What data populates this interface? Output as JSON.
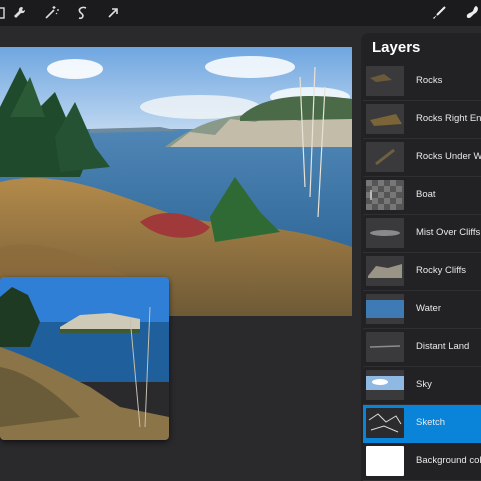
{
  "toolbar": {
    "left_icons": [
      "wrench-icon",
      "magic-wand-icon",
      "selection-icon",
      "transform-arrow-icon"
    ],
    "right_icons": [
      "brush-icon",
      "smudge-icon"
    ]
  },
  "layers_panel": {
    "title": "Layers",
    "selected_layer": "Sketch",
    "layers": [
      {
        "name": "Rocks"
      },
      {
        "name": "Rocks Right End"
      },
      {
        "name": "Rocks Under W"
      },
      {
        "name": "Boat"
      },
      {
        "name": "Mist Over Cliffs"
      },
      {
        "name": "Rocky Cliffs"
      },
      {
        "name": "Water"
      },
      {
        "name": "Distant Land"
      },
      {
        "name": "Sky"
      },
      {
        "name": "Sketch"
      },
      {
        "name": "Background col"
      }
    ]
  },
  "colors": {
    "accent": "#0a84d8",
    "panel_bg": "#222224",
    "workspace_bg": "#2a2a2c",
    "topbar_bg": "#1b1b1d"
  }
}
